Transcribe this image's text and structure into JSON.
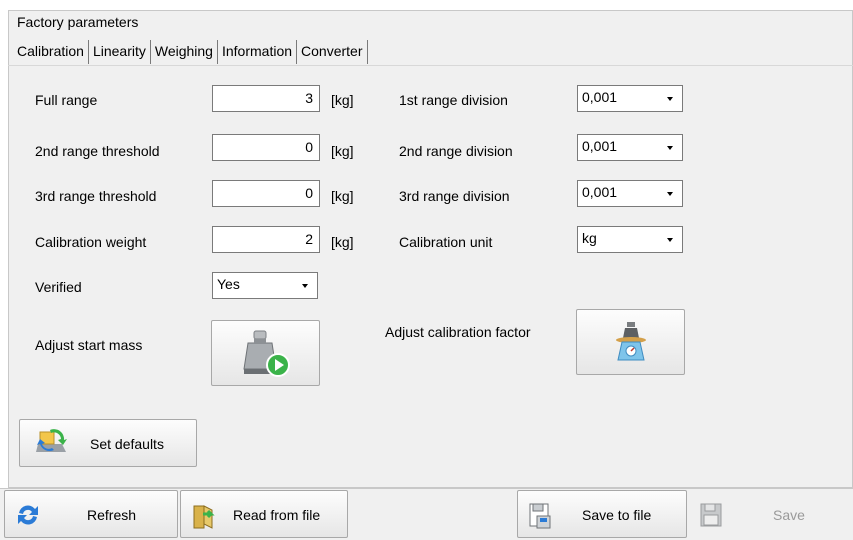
{
  "panel": {
    "title": "Factory parameters"
  },
  "tabs": [
    "Calibration",
    "Linearity",
    "Weighing",
    "Information",
    "Converter"
  ],
  "active_tab": "Calibration",
  "fields": {
    "full_range": {
      "label": "Full range",
      "value": "3",
      "unit": "[kg]"
    },
    "range2_threshold": {
      "label": "2nd range threshold",
      "value": "0",
      "unit": "[kg]"
    },
    "range3_threshold": {
      "label": "3rd range threshold",
      "value": "0",
      "unit": "[kg]"
    },
    "calibration_weight": {
      "label": "Calibration weight",
      "value": "2",
      "unit": "[kg]"
    },
    "verified": {
      "label": "Verified",
      "value": "Yes"
    },
    "range1_division": {
      "label": "1st range division",
      "value": "0,001"
    },
    "range2_division": {
      "label": "2nd range division",
      "value": "0,001"
    },
    "range3_division": {
      "label": "3rd range division",
      "value": "0,001"
    },
    "calibration_unit": {
      "label": "Calibration unit",
      "value": "kg"
    }
  },
  "actions": {
    "adjust_start_mass": {
      "label": "Adjust start mass",
      "icon": "weight-play-icon"
    },
    "adjust_calibration_factor": {
      "label": "Adjust calibration factor",
      "icon": "scale-icon"
    },
    "set_defaults": {
      "label": "Set defaults",
      "icon": "defaults-icon"
    }
  },
  "toolbar": {
    "refresh": {
      "label": "Refresh",
      "icon": "refresh-icon"
    },
    "read_from_file": {
      "label": "Read from file",
      "icon": "open-file-icon"
    },
    "save_to_file": {
      "label": "Save to file",
      "icon": "save-to-file-icon"
    },
    "save": {
      "label": "Save",
      "icon": "floppy-icon",
      "enabled": false
    }
  },
  "colors": {
    "panel_bg": "#f0f0f0",
    "accent_blue": "#2b7bd6",
    "accent_green": "#3bb34a"
  }
}
